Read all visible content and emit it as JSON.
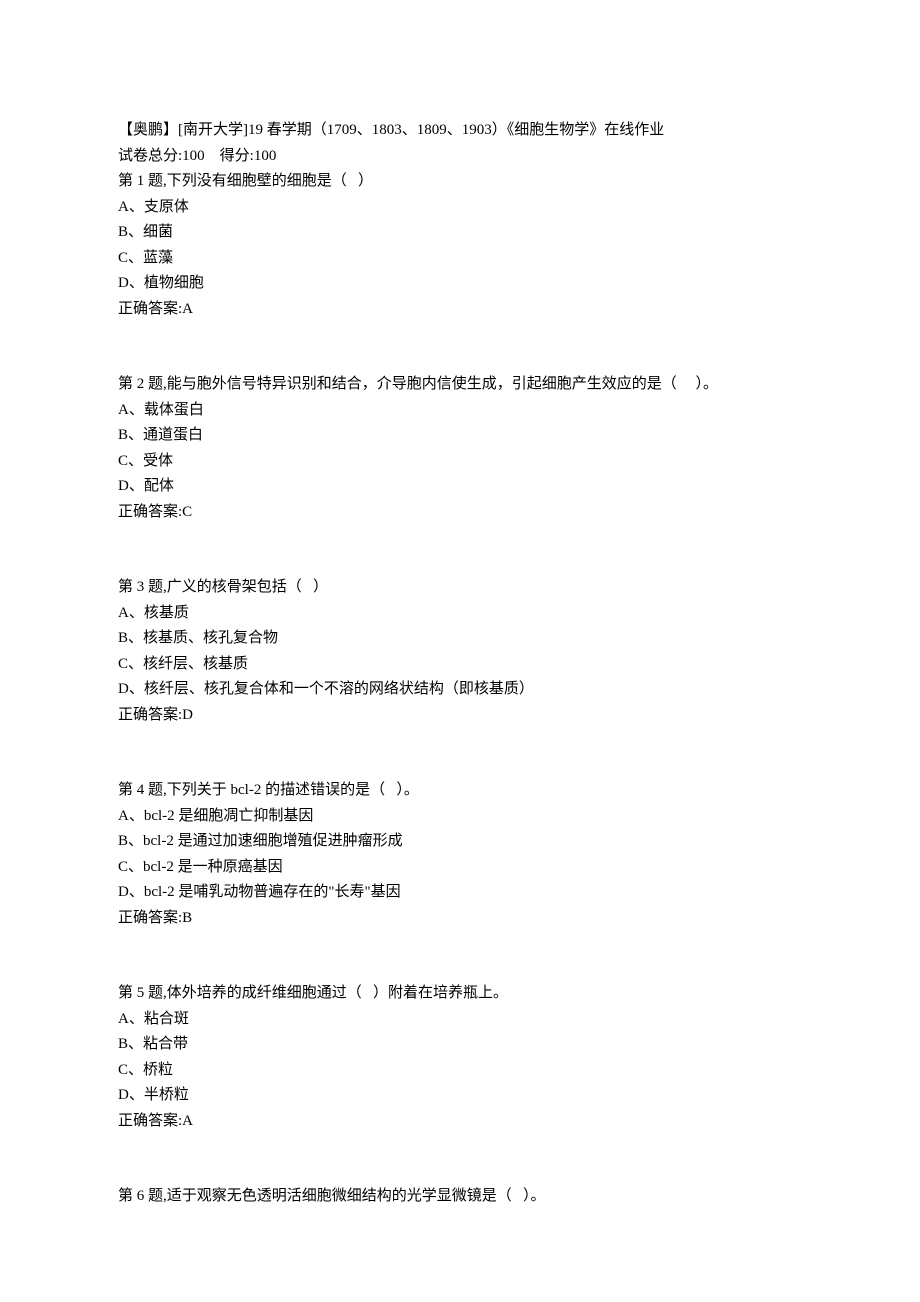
{
  "header": "【奥鹏】[南开大学]19 春学期（1709、1803、1809、1903）《细胞生物学》在线作业",
  "score_line": "试卷总分:100    得分:100",
  "questions": [
    {
      "title": "第 1 题,下列没有细胞壁的细胞是（   ）",
      "options": [
        "A、支原体",
        "B、细菌",
        "C、蓝藻",
        "D、植物细胞"
      ],
      "answer": "正确答案:A"
    },
    {
      "title": "第 2 题,能与胞外信号特异识别和结合，介导胞内信使生成，引起细胞产生效应的是（     ）。",
      "options": [
        "A、载体蛋白",
        "B、通道蛋白",
        "C、受体",
        "D、配体"
      ],
      "answer": "正确答案:C"
    },
    {
      "title": "第 3 题,广义的核骨架包括（   ）",
      "options": [
        "A、核基质",
        "B、核基质、核孔复合物",
        "C、核纤层、核基质",
        "D、核纤层、核孔复合体和一个不溶的网络状结构（即核基质）"
      ],
      "answer": "正确答案:D"
    },
    {
      "title": "第 4 题,下列关于 bcl-2 的描述错误的是（   ）。",
      "options": [
        "A、bcl-2 是细胞凋亡抑制基因",
        "B、bcl-2 是通过加速细胞增殖促进肿瘤形成",
        "C、bcl-2 是一种原癌基因",
        "D、bcl-2 是哺乳动物普遍存在的\"长寿\"基因"
      ],
      "answer": "正确答案:B"
    },
    {
      "title": "第 5 题,体外培养的成纤维细胞通过（   ）附着在培养瓶上。",
      "options": [
        "A、粘合斑",
        "B、粘合带",
        "C、桥粒",
        "D、半桥粒"
      ],
      "answer": "正确答案:A"
    },
    {
      "title": "第 6 题,适于观察无色透明活细胞微细结构的光学显微镜是（   ）。",
      "options": [],
      "answer": ""
    }
  ]
}
